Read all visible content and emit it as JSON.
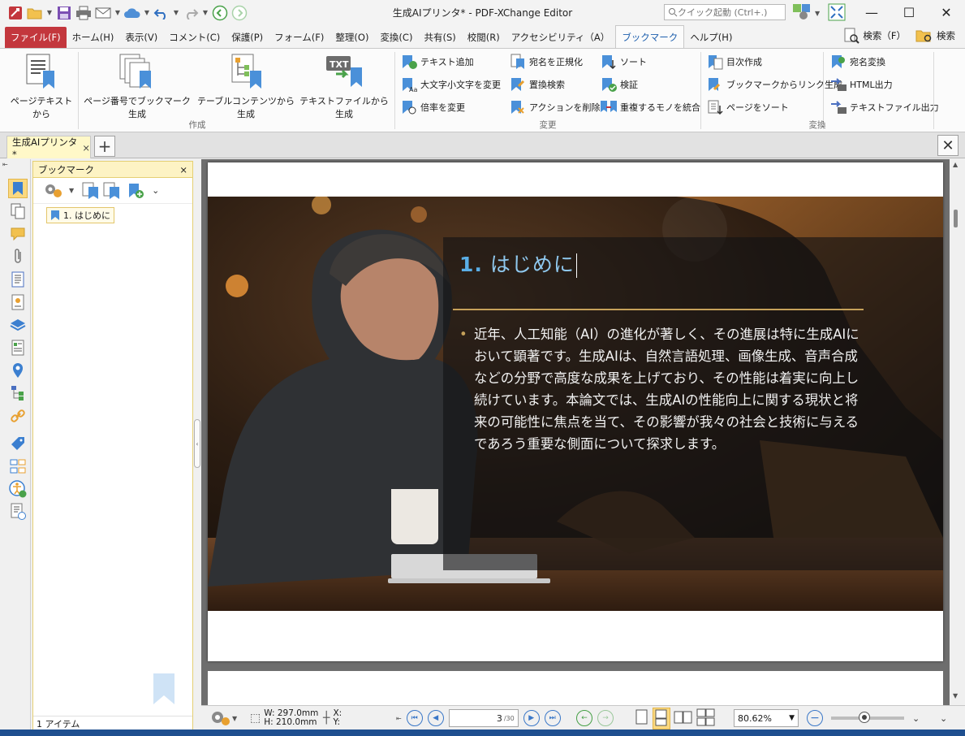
{
  "window": {
    "title": "生成AIプリンタ* - PDF-XChange Editor",
    "quick_launch_placeholder": "クイック起動 (Ctrl+.)",
    "minimize": "—",
    "maximize": "☐",
    "close": "✕"
  },
  "ribbon_tabs": {
    "file": "ファイル(F)",
    "items": [
      "ホーム(H)",
      "表示(V)",
      "コメント(C)",
      "保護(P)",
      "フォーム(F)",
      "整理(O)",
      "変換(C)",
      "共有(S)",
      "校閲(R)",
      "アクセシビリティ（A）",
      "ブックマーク",
      "ヘルプ(H)"
    ],
    "search_left": "検索（F）",
    "search_right": "検索"
  },
  "ribbon": {
    "create": {
      "label": "作成",
      "buttons": [
        "ページテキストから",
        "ページ番号でブックマーク生成",
        "テーブルコンテンツから生成",
        "テキストファイルから生成"
      ]
    },
    "modify": {
      "label": "変更",
      "col1": [
        "テキスト追加",
        "大文字小文字を変更",
        "倍率を変更"
      ],
      "col2": [
        "宛名を正規化",
        "置換検索",
        "アクションを削除"
      ],
      "col3": [
        "ソート",
        "検証",
        "重複するモノを統合"
      ]
    },
    "convert": {
      "label": "変換",
      "col1": [
        "目次作成",
        "ブックマークからリンク生成",
        "ページをソート"
      ],
      "col2": [
        "宛名変換",
        "HTML出力",
        "テキストファイル出力"
      ]
    }
  },
  "doc_tab": {
    "title": "生成AIプリンタ *",
    "close": "×",
    "add": "+"
  },
  "bookmarks_pane": {
    "title": "ブックマーク",
    "close": "×",
    "item": "1. はじめに",
    "status": "1 アイテム"
  },
  "page_content": {
    "heading_num": "1.",
    "heading_text": "はじめに",
    "paragraph": "近年、人工知能（AI）の進化が著しく、その進展は特に生成AIにおいて顕著です。生成AIは、自然言語処理、画像生成、音声合成などの分野で高度な成果を上げており、その性能は着実に向上し続けています。本論文では、生成AIの性能向上に関する現状と将来の可能性に焦点を当て、その影響が我々の社会と技術に与えるであろう重要な側面について探求します。"
  },
  "statusbar": {
    "width": "W: 297.0mm",
    "height": "H: 210.0mm",
    "x": "X:",
    "y": "Y:",
    "page_current": "3",
    "page_total": "/30",
    "zoom": "80.62%",
    "zoom_slider_level": 0.45
  },
  "colors": {
    "file_tab": "#c3373d",
    "accent": "#1e5fae",
    "selection": "#fbd980",
    "heading": "#8fc8ee",
    "rule": "#c6a15a"
  }
}
